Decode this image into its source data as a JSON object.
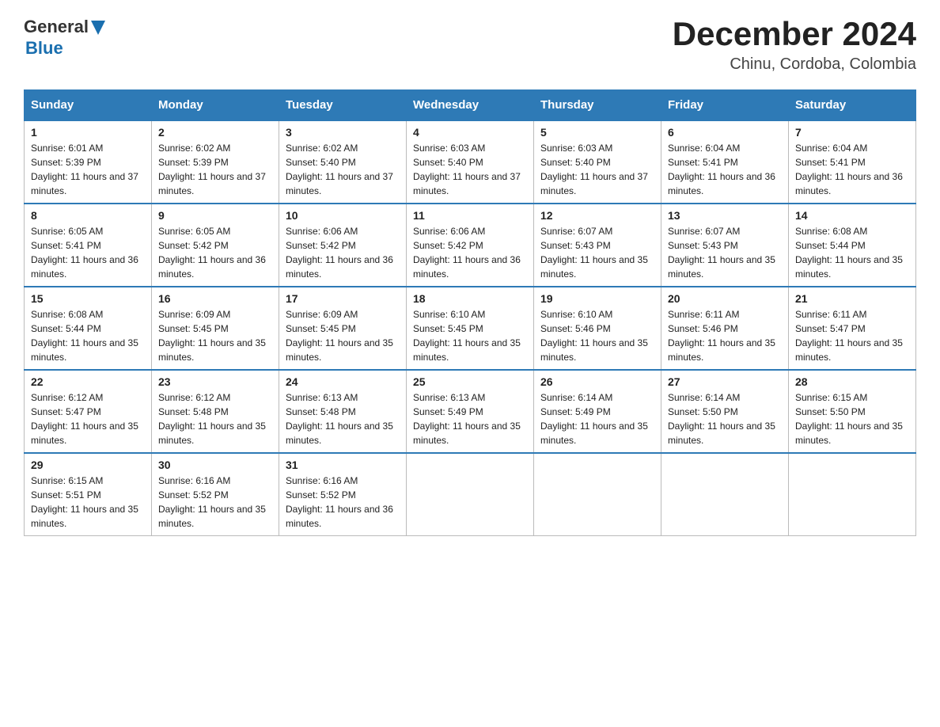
{
  "header": {
    "logo_general": "General",
    "logo_blue": "Blue",
    "month_year": "December 2024",
    "location": "Chinu, Cordoba, Colombia"
  },
  "days_of_week": [
    "Sunday",
    "Monday",
    "Tuesday",
    "Wednesday",
    "Thursday",
    "Friday",
    "Saturday"
  ],
  "weeks": [
    [
      {
        "day": "1",
        "sunrise": "6:01 AM",
        "sunset": "5:39 PM",
        "daylight": "11 hours and 37 minutes."
      },
      {
        "day": "2",
        "sunrise": "6:02 AM",
        "sunset": "5:39 PM",
        "daylight": "11 hours and 37 minutes."
      },
      {
        "day": "3",
        "sunrise": "6:02 AM",
        "sunset": "5:40 PM",
        "daylight": "11 hours and 37 minutes."
      },
      {
        "day": "4",
        "sunrise": "6:03 AM",
        "sunset": "5:40 PM",
        "daylight": "11 hours and 37 minutes."
      },
      {
        "day": "5",
        "sunrise": "6:03 AM",
        "sunset": "5:40 PM",
        "daylight": "11 hours and 37 minutes."
      },
      {
        "day": "6",
        "sunrise": "6:04 AM",
        "sunset": "5:41 PM",
        "daylight": "11 hours and 36 minutes."
      },
      {
        "day": "7",
        "sunrise": "6:04 AM",
        "sunset": "5:41 PM",
        "daylight": "11 hours and 36 minutes."
      }
    ],
    [
      {
        "day": "8",
        "sunrise": "6:05 AM",
        "sunset": "5:41 PM",
        "daylight": "11 hours and 36 minutes."
      },
      {
        "day": "9",
        "sunrise": "6:05 AM",
        "sunset": "5:42 PM",
        "daylight": "11 hours and 36 minutes."
      },
      {
        "day": "10",
        "sunrise": "6:06 AM",
        "sunset": "5:42 PM",
        "daylight": "11 hours and 36 minutes."
      },
      {
        "day": "11",
        "sunrise": "6:06 AM",
        "sunset": "5:42 PM",
        "daylight": "11 hours and 36 minutes."
      },
      {
        "day": "12",
        "sunrise": "6:07 AM",
        "sunset": "5:43 PM",
        "daylight": "11 hours and 35 minutes."
      },
      {
        "day": "13",
        "sunrise": "6:07 AM",
        "sunset": "5:43 PM",
        "daylight": "11 hours and 35 minutes."
      },
      {
        "day": "14",
        "sunrise": "6:08 AM",
        "sunset": "5:44 PM",
        "daylight": "11 hours and 35 minutes."
      }
    ],
    [
      {
        "day": "15",
        "sunrise": "6:08 AM",
        "sunset": "5:44 PM",
        "daylight": "11 hours and 35 minutes."
      },
      {
        "day": "16",
        "sunrise": "6:09 AM",
        "sunset": "5:45 PM",
        "daylight": "11 hours and 35 minutes."
      },
      {
        "day": "17",
        "sunrise": "6:09 AM",
        "sunset": "5:45 PM",
        "daylight": "11 hours and 35 minutes."
      },
      {
        "day": "18",
        "sunrise": "6:10 AM",
        "sunset": "5:45 PM",
        "daylight": "11 hours and 35 minutes."
      },
      {
        "day": "19",
        "sunrise": "6:10 AM",
        "sunset": "5:46 PM",
        "daylight": "11 hours and 35 minutes."
      },
      {
        "day": "20",
        "sunrise": "6:11 AM",
        "sunset": "5:46 PM",
        "daylight": "11 hours and 35 minutes."
      },
      {
        "day": "21",
        "sunrise": "6:11 AM",
        "sunset": "5:47 PM",
        "daylight": "11 hours and 35 minutes."
      }
    ],
    [
      {
        "day": "22",
        "sunrise": "6:12 AM",
        "sunset": "5:47 PM",
        "daylight": "11 hours and 35 minutes."
      },
      {
        "day": "23",
        "sunrise": "6:12 AM",
        "sunset": "5:48 PM",
        "daylight": "11 hours and 35 minutes."
      },
      {
        "day": "24",
        "sunrise": "6:13 AM",
        "sunset": "5:48 PM",
        "daylight": "11 hours and 35 minutes."
      },
      {
        "day": "25",
        "sunrise": "6:13 AM",
        "sunset": "5:49 PM",
        "daylight": "11 hours and 35 minutes."
      },
      {
        "day": "26",
        "sunrise": "6:14 AM",
        "sunset": "5:49 PM",
        "daylight": "11 hours and 35 minutes."
      },
      {
        "day": "27",
        "sunrise": "6:14 AM",
        "sunset": "5:50 PM",
        "daylight": "11 hours and 35 minutes."
      },
      {
        "day": "28",
        "sunrise": "6:15 AM",
        "sunset": "5:50 PM",
        "daylight": "11 hours and 35 minutes."
      }
    ],
    [
      {
        "day": "29",
        "sunrise": "6:15 AM",
        "sunset": "5:51 PM",
        "daylight": "11 hours and 35 minutes."
      },
      {
        "day": "30",
        "sunrise": "6:16 AM",
        "sunset": "5:52 PM",
        "daylight": "11 hours and 35 minutes."
      },
      {
        "day": "31",
        "sunrise": "6:16 AM",
        "sunset": "5:52 PM",
        "daylight": "11 hours and 36 minutes."
      },
      null,
      null,
      null,
      null
    ]
  ]
}
